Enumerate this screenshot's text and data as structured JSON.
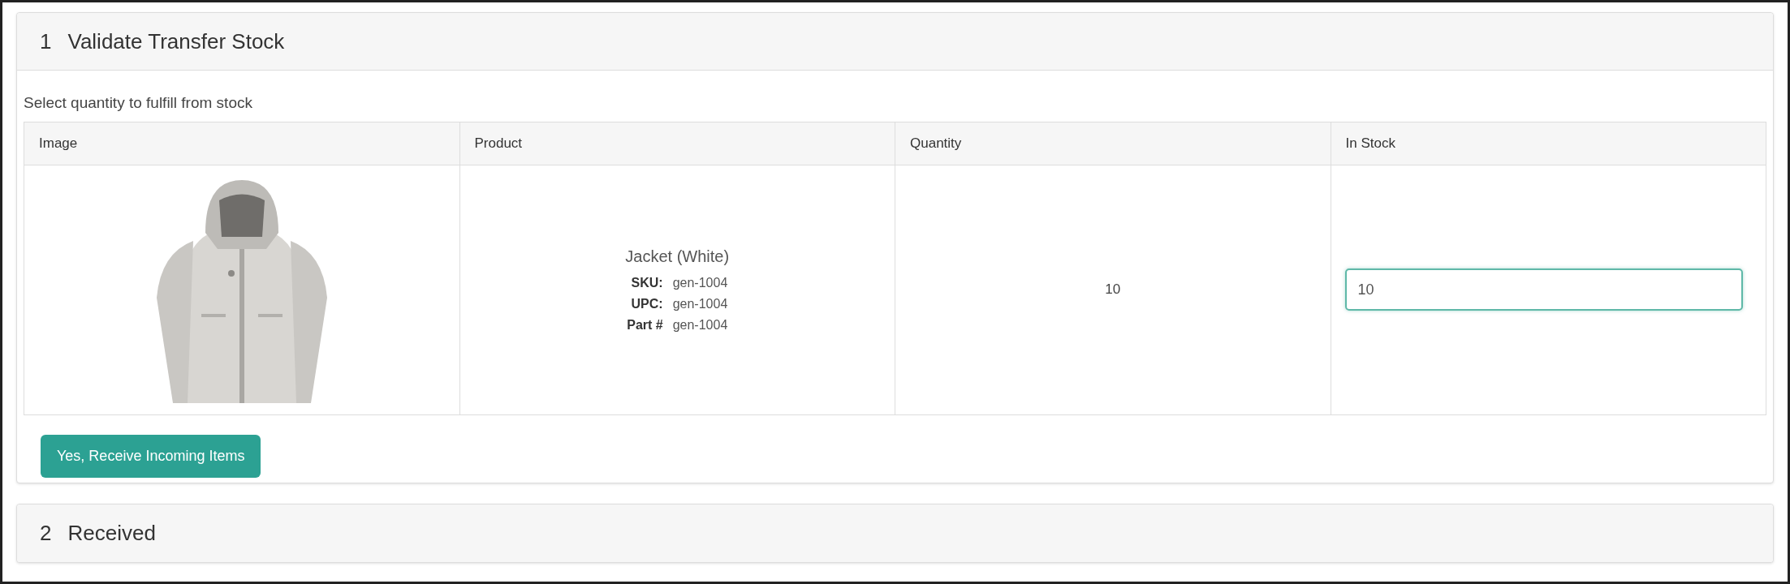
{
  "steps": [
    {
      "number": "1",
      "title": "Validate Transfer Stock",
      "expanded": true,
      "instruction": "Select quantity to fulfill from stock",
      "table": {
        "columns": [
          "Image",
          "Product",
          "Quantity",
          "In Stock"
        ],
        "rows": [
          {
            "product": {
              "name": "Jacket (White)",
              "details": [
                {
                  "label": "SKU:",
                  "value": "gen-1004"
                },
                {
                  "label": "UPC:",
                  "value": "gen-1004"
                },
                {
                  "label": "Part #",
                  "value": "gen-1004"
                }
              ]
            },
            "quantity": "10",
            "in_stock": "10"
          }
        ]
      },
      "button": "Yes, Receive Incoming Items"
    },
    {
      "number": "2",
      "title": "Received",
      "expanded": false
    }
  ]
}
